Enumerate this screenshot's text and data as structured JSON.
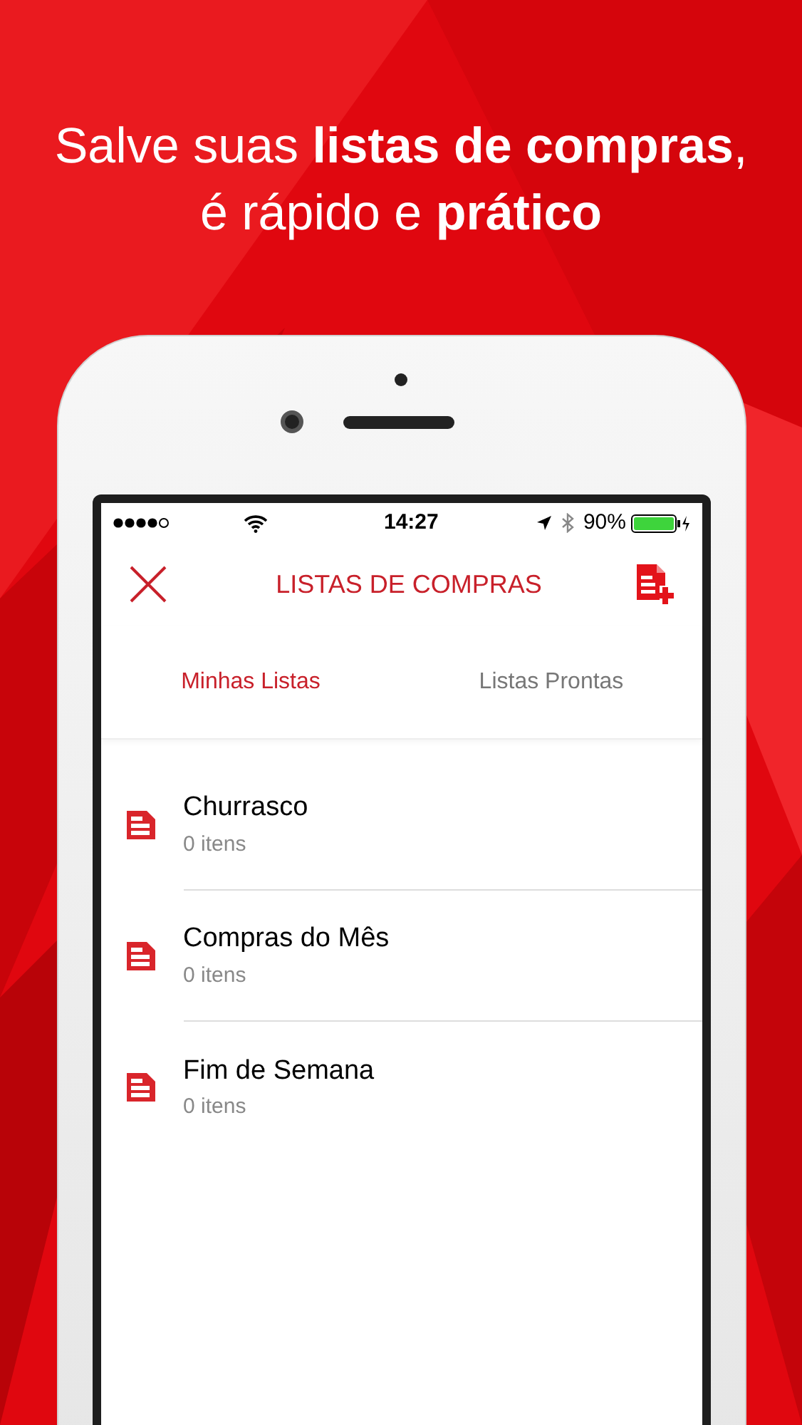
{
  "headline": [
    "Salve suas **listas de compras**,",
    "é rápido e **prático**"
  ],
  "status_bar": {
    "time": "14:27",
    "battery": "90%"
  },
  "nav": {
    "title": "LISTAS DE COMPRAS"
  },
  "tabs": [
    {
      "label": "Minhas Listas",
      "selected": true
    },
    {
      "label": "Listas Prontas",
      "selected": false
    }
  ],
  "lists": [
    {
      "name": "Churrasco",
      "count": "0 itens"
    },
    {
      "name": "Compras do Mês",
      "count": "0 itens"
    },
    {
      "name": "Fim de Semana",
      "count": "0 itens"
    }
  ]
}
